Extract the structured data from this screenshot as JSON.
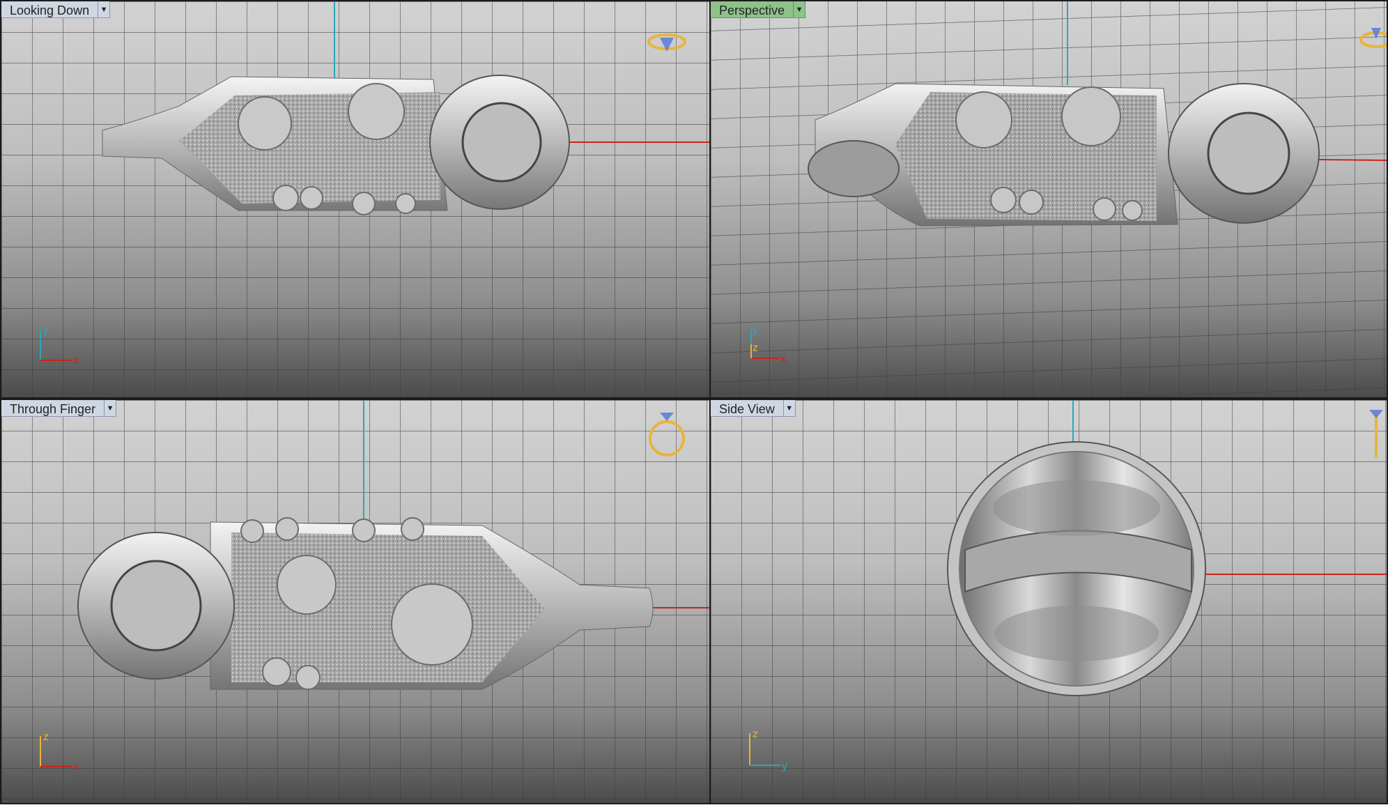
{
  "viewports": [
    {
      "id": "looking-down",
      "title": "Looking Down",
      "active": false,
      "axes": [
        "y",
        "x"
      ]
    },
    {
      "id": "perspective",
      "title": "Perspective",
      "active": true,
      "axes": [
        "y",
        "z",
        "x"
      ]
    },
    {
      "id": "through-finger",
      "title": "Through Finger",
      "active": false,
      "axes": [
        "z",
        "x"
      ]
    },
    {
      "id": "side-view",
      "title": "Side View",
      "active": false,
      "axes": [
        "z",
        "y"
      ]
    }
  ],
  "colors": {
    "grid": "#3c3c3c",
    "axis_red": "#c8251c",
    "axis_cyan": "#2ea6b8",
    "gizmo_gold": "#e8b43a",
    "gizmo_blue": "#5a7ad8",
    "active_tab": "#8dc28a",
    "inactive_tab": "#cfd7e2"
  },
  "icons": {
    "dropdown": "chevron-down-icon",
    "gem_orientation": "ring-gem-orientation-icon"
  }
}
